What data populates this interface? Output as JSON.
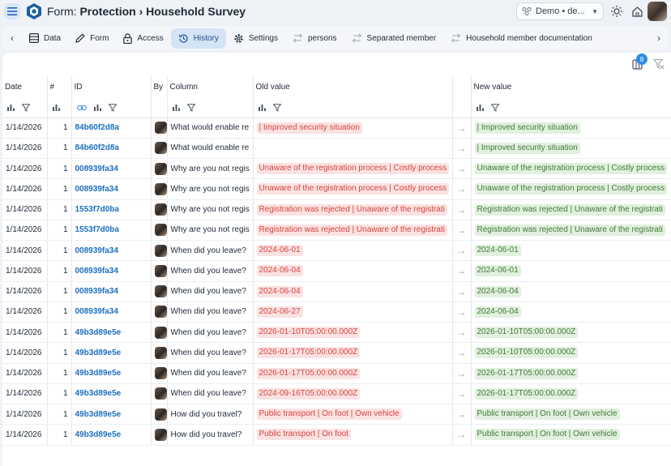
{
  "app": {
    "title_prefix": "Form: ",
    "title_main": "Protection",
    "title_sep": " › ",
    "title_sub": "Household Survey",
    "db_selector": "Demo • de...",
    "accent": "#2f8ce0"
  },
  "tabs": [
    {
      "label": "Data",
      "icon": "table-icon",
      "active": false
    },
    {
      "label": "Form",
      "icon": "pencil-icon",
      "active": false
    },
    {
      "label": "Access",
      "icon": "lock-icon",
      "active": false
    },
    {
      "label": "History",
      "icon": "history-icon",
      "active": true
    },
    {
      "label": "Settings",
      "icon": "gear-icon",
      "active": false
    },
    {
      "label": "persons",
      "icon": "swap-icon",
      "active": false
    },
    {
      "label": "Separated member",
      "icon": "swap-icon",
      "active": false
    },
    {
      "label": "Household member documentation",
      "icon": "swap-icon",
      "active": false
    }
  ],
  "toolbar": {
    "filter_badge": "8"
  },
  "columns": {
    "date": "Date",
    "num": "#",
    "id": "ID",
    "by": "By",
    "column": "Column",
    "old": "Old value",
    "new": "New value"
  },
  "rows": [
    {
      "date": "1/14/2026",
      "num": "1",
      "id": "84b60f2d8a",
      "column": "What would enable re",
      "old": "| Improved security situation",
      "new": "| Improved security situation"
    },
    {
      "date": "1/14/2026",
      "num": "1",
      "id": "84b60f2d8a",
      "column": "What would enable re",
      "old": "",
      "new": "| Improved security situation"
    },
    {
      "date": "1/14/2026",
      "num": "1",
      "id": "008939fa34",
      "column": "Why are you not regis",
      "old": "Unaware of the registration process | Costly process",
      "new": "Unaware of the registration process | Costly process"
    },
    {
      "date": "1/14/2026",
      "num": "1",
      "id": "008939fa34",
      "column": "Why are you not regis",
      "old": "Unaware of the registration process | Costly process",
      "new": "Unaware of the registration process | Costly process"
    },
    {
      "date": "1/14/2026",
      "num": "1",
      "id": "1553f7d0ba",
      "column": "Why are you not regis",
      "old": "Registration was rejected | Unaware of the registrati",
      "new": "Registration was rejected | Unaware of the registrati"
    },
    {
      "date": "1/14/2026",
      "num": "1",
      "id": "1553f7d0ba",
      "column": "Why are you not regis",
      "old": "Registration was rejected | Unaware of the registrati",
      "new": "Registration was rejected | Unaware of the registrati"
    },
    {
      "date": "1/14/2026",
      "num": "1",
      "id": "008939fa34",
      "column": "When did you leave?",
      "old": "2024-06-01",
      "new": "2024-06-01"
    },
    {
      "date": "1/14/2026",
      "num": "1",
      "id": "008939fa34",
      "column": "When did you leave?",
      "old": "2024-06-04",
      "new": "2024-06-01"
    },
    {
      "date": "1/14/2026",
      "num": "1",
      "id": "008939fa34",
      "column": "When did you leave?",
      "old": "2024-06-04",
      "new": "2024-06-04"
    },
    {
      "date": "1/14/2026",
      "num": "1",
      "id": "008939fa34",
      "column": "When did you leave?",
      "old": "2024-06-27",
      "new": "2024-06-04"
    },
    {
      "date": "1/14/2026",
      "num": "1",
      "id": "49b3d89e5e",
      "column": "When did you leave?",
      "old": "2026-01-10T05:00:00.000Z",
      "new": "2026-01-10T05:00:00.000Z"
    },
    {
      "date": "1/14/2026",
      "num": "1",
      "id": "49b3d89e5e",
      "column": "When did you leave?",
      "old": "2026-01-17T05:00:00.000Z",
      "new": "2026-01-10T05:00:00.000Z"
    },
    {
      "date": "1/14/2026",
      "num": "1",
      "id": "49b3d89e5e",
      "column": "When did you leave?",
      "old": "2026-01-17T05:00:00.000Z",
      "new": "2026-01-17T05:00:00.000Z"
    },
    {
      "date": "1/14/2026",
      "num": "1",
      "id": "49b3d89e5e",
      "column": "When did you leave?",
      "old": "2024-09-16T05:00:00.000Z",
      "new": "2026-01-17T05:00:00.000Z"
    },
    {
      "date": "1/14/2026",
      "num": "1",
      "id": "49b3d89e5e",
      "column": "How did you travel?",
      "old": "Public transport | On foot | Own vehicle",
      "new": "Public transport | On foot | Own vehicle"
    },
    {
      "date": "1/14/2026",
      "num": "1",
      "id": "49b3d89e5e",
      "column": "How did you travel?",
      "old": "Public transport | On foot",
      "new": "Public transport | On foot | Own vehicle"
    }
  ]
}
